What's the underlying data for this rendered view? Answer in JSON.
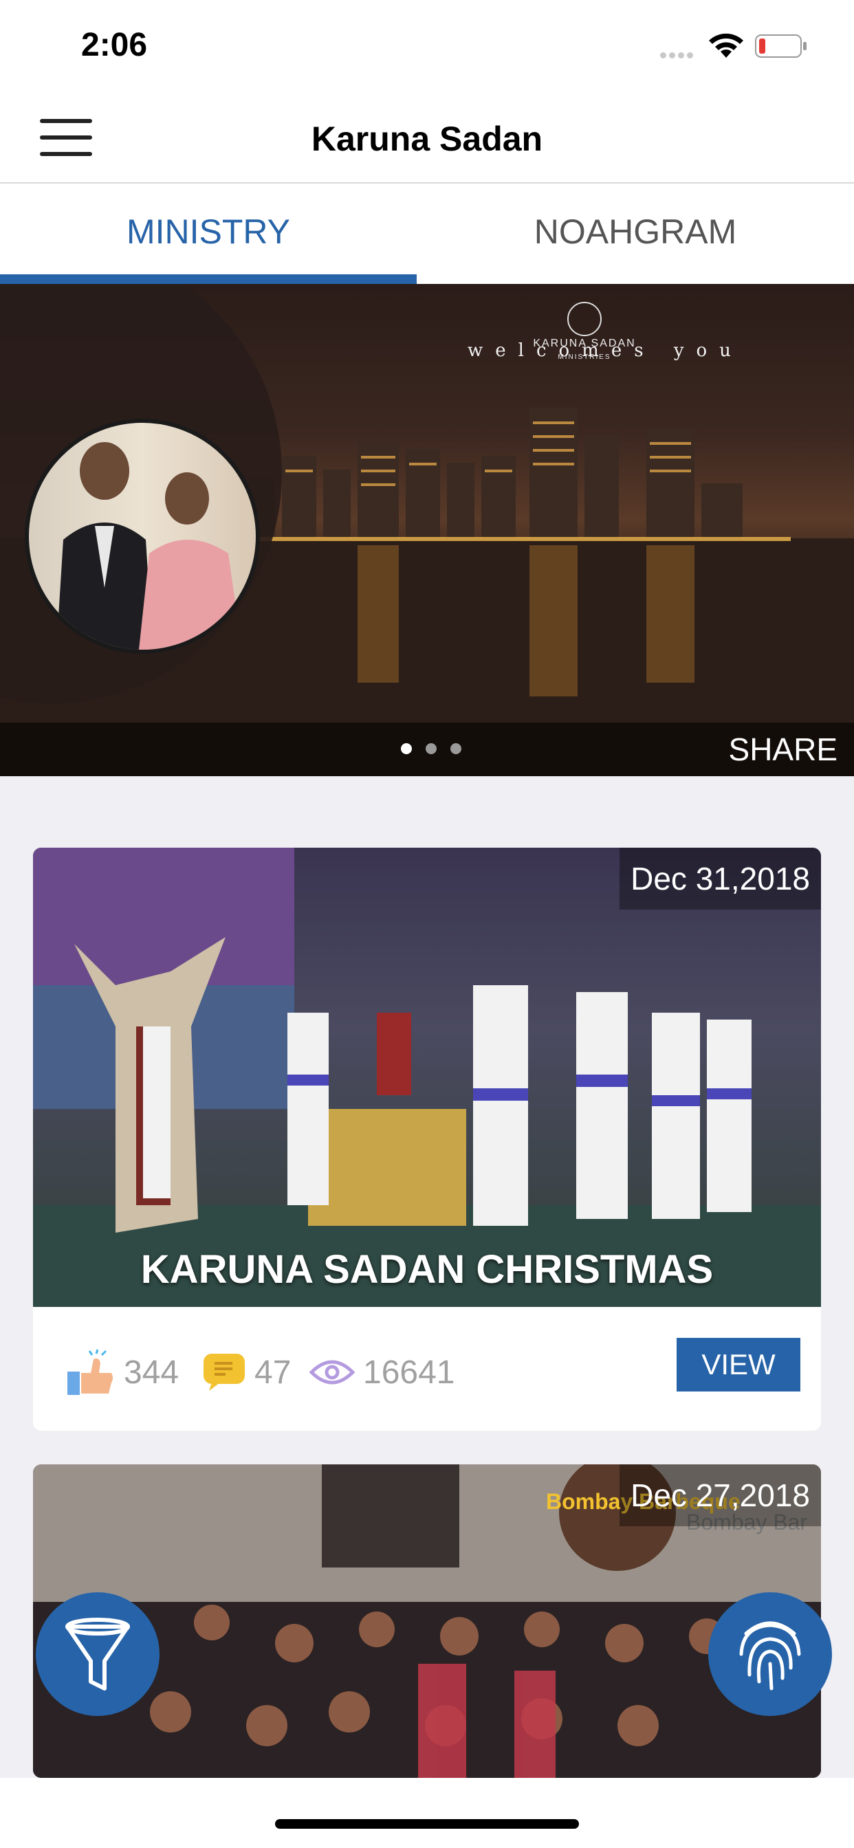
{
  "status": {
    "time": "2:06"
  },
  "header": {
    "title": "Karuna Sadan"
  },
  "tabs": [
    {
      "label": "MINISTRY",
      "active": true
    },
    {
      "label": "NOAHGRAM",
      "active": false
    }
  ],
  "banner": {
    "logo_text": "KARUNA SADAN",
    "logo_subtext": "MINISTRIES",
    "tagline": "welcomes you",
    "share_label": "SHARE",
    "slides_total": 3,
    "slide_active": 1
  },
  "posts": [
    {
      "date": "Dec 31,2018",
      "title": "KARUNA SADAN CHRISTMAS",
      "likes": "344",
      "comments": "47",
      "views": "16641",
      "view_label": "VIEW"
    },
    {
      "date": "Dec 27,2018",
      "sign_text": "Bombay Barbeque",
      "sign_text_right": "Bombay Bar"
    }
  ],
  "icons": {
    "menu": "hamburger-icon",
    "like": "thumbs-up-icon",
    "comment": "comment-icon",
    "views": "eye-icon",
    "filter": "filter-funnel-icon",
    "fingerprint": "fingerprint-icon"
  },
  "colors": {
    "accent": "#2763a8",
    "like": "#6aa8e8",
    "comment": "#f2c230",
    "views": "#b49be0"
  }
}
